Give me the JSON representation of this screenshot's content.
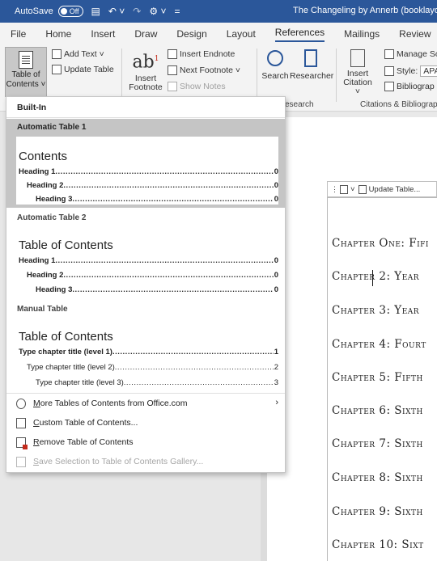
{
  "titlebar": {
    "autosave_label": "AutoSave",
    "autosave_state": "Off",
    "doc_title": "The Changeling by Annerb (booklayout"
  },
  "tabs": [
    "File",
    "Home",
    "Insert",
    "Draw",
    "Design",
    "Layout",
    "References",
    "Mailings",
    "Review",
    "V"
  ],
  "active_tab": "References",
  "ribbon": {
    "toc": {
      "line1": "Table of",
      "line2": "Contents ˅"
    },
    "add_text": "Add Text ˅",
    "update_table": "Update Table",
    "insert_footnote": {
      "line1": "Insert",
      "line2": "Footnote"
    },
    "insert_endnote": "Insert Endnote",
    "next_footnote": "Next Footnote ˅",
    "show_notes": "Show Notes",
    "search": "Search",
    "researcher": "Researcher",
    "research_group": "esearch",
    "insert_citation": {
      "line1": "Insert",
      "line2": "Citation ˅"
    },
    "manage_sources": "Manage So",
    "style_label": "Style:",
    "style_value": "APA",
    "bibliography": "Bibliograp",
    "citations_group": "Citations & Bibliograp"
  },
  "dropdown": {
    "builtin_label": "Built-In",
    "auto1": {
      "label": "Automatic Table 1",
      "title": "Contents",
      "lines": [
        {
          "text": "Heading 1",
          "page": "0"
        },
        {
          "text": "Heading 2",
          "page": "0"
        },
        {
          "text": "Heading 3",
          "page": "0"
        }
      ]
    },
    "auto2": {
      "label": "Automatic Table 2",
      "title": "Table of Contents",
      "lines": [
        {
          "text": "Heading 1",
          "page": "0"
        },
        {
          "text": "Heading 2",
          "page": "0"
        },
        {
          "text": "Heading 3",
          "page": "0"
        }
      ]
    },
    "manual": {
      "label": "Manual Table",
      "title": "Table of Contents",
      "lines": [
        {
          "text": "Type chapter title (level 1)",
          "page": "1"
        },
        {
          "text": "Type chapter title (level 2)",
          "page": "2"
        },
        {
          "text": "Type chapter title (level 3)",
          "page": "3"
        }
      ]
    },
    "menu": {
      "more": {
        "u": "M",
        "rest": "ore Tables of Contents from Office.com"
      },
      "custom": {
        "u": "C",
        "rest": "ustom Table of Contents..."
      },
      "remove": {
        "u": "R",
        "rest": "emove Table of Contents"
      },
      "save": {
        "u": "S",
        "rest": "ave Selection to Table of Contents Gallery..."
      }
    }
  },
  "document": {
    "field_bar_label": "Update Table...",
    "chapters": [
      "Chapter One:  Fifi",
      "Chapter 2:  Year",
      "Chapter 3:  Year",
      "Chapter 4:  Fourt",
      "Chapter 5:  Fifth",
      "Chapter 6:  Sixth",
      "Chapter 7:  Sixth",
      "Chapter 8:  Sixth",
      "Chapter 9: Sixth",
      "Chapter 10:  Sixt"
    ]
  }
}
